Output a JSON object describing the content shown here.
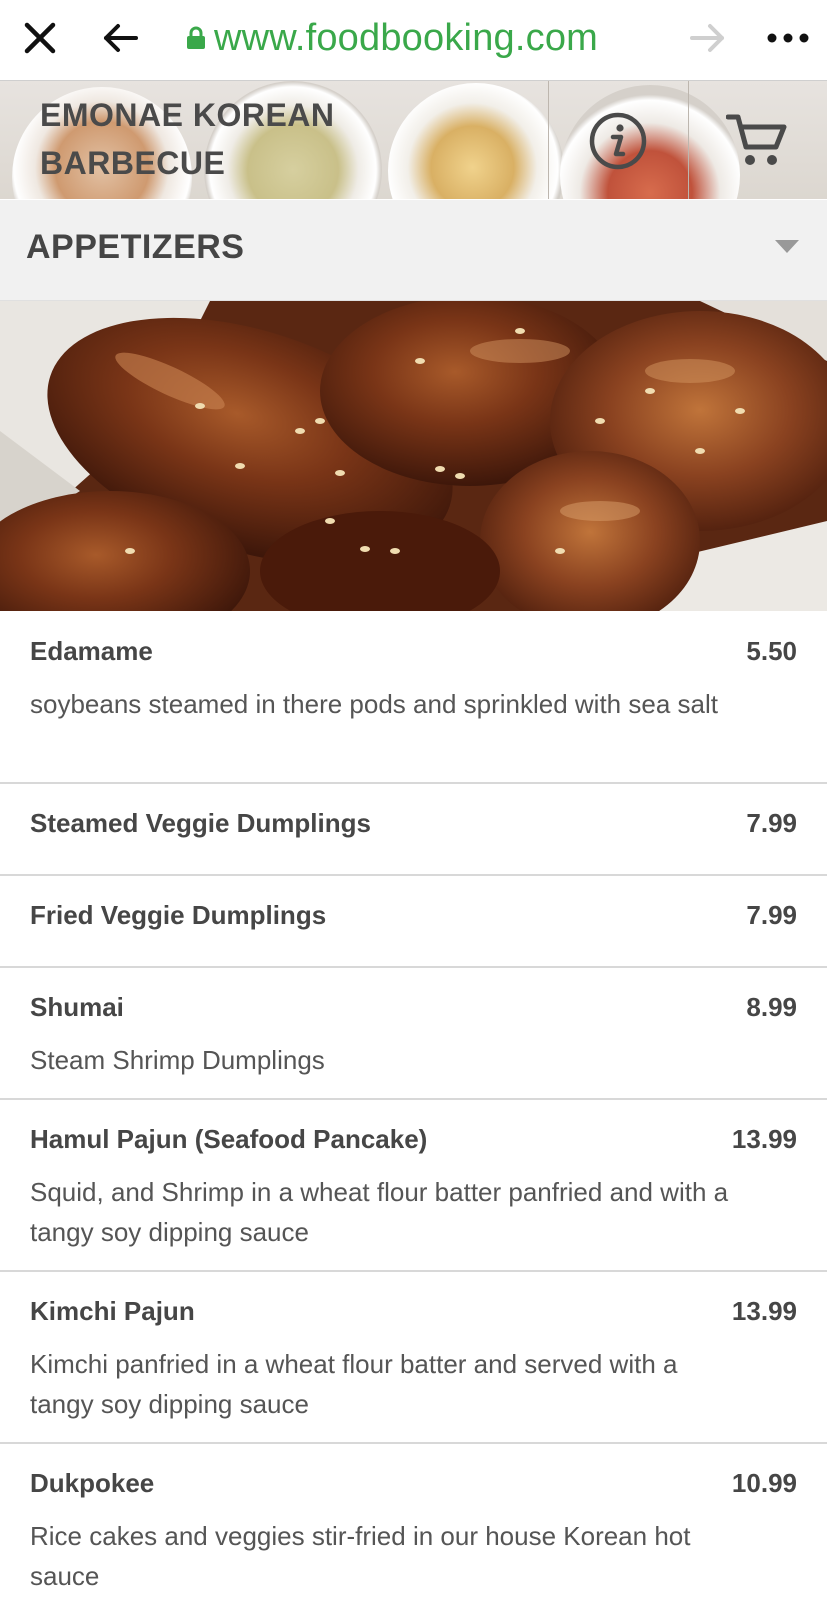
{
  "browser": {
    "url": "www.foodbooking.com",
    "icons": {
      "close": "close-icon",
      "back": "back-arrow-icon",
      "lock": "lock-icon",
      "forward": "forward-arrow-icon",
      "more": "more-dots-icon"
    },
    "accent_color": "#3aa84a"
  },
  "restaurant": {
    "name_line1": "EMONAE KOREAN",
    "name_line2": "BARBECUE",
    "icons": {
      "info": "info-icon",
      "cart": "cart-icon"
    }
  },
  "category": {
    "title": "APPETIZERS",
    "icon": "caret-down-icon"
  },
  "menu": {
    "items": [
      {
        "name": "Edamame",
        "price": "5.50",
        "description": "soybeans steamed in there pods and sprinkled with sea salt"
      },
      {
        "name": "Steamed Veggie Dumplings",
        "price": "7.99",
        "description": ""
      },
      {
        "name": "Fried Veggie Dumplings",
        "price": "7.99",
        "description": ""
      },
      {
        "name": "Shumai",
        "price": "8.99",
        "description": "Steam Shrimp Dumplings"
      },
      {
        "name": "Hamul Pajun (Seafood Pancake)",
        "price": "13.99",
        "description": "Squid, and Shrimp in a wheat flour batter panfried and with a tangy soy dipping sauce"
      },
      {
        "name": "Kimchi Pajun",
        "price": "13.99",
        "description": "Kimchi panfried in a wheat flour batter and served with a tangy soy dipping sauce"
      },
      {
        "name": "Dukpokee",
        "price": "10.99",
        "description": "Rice cakes and veggies stir-fried in our house Korean hot sauce"
      }
    ]
  }
}
